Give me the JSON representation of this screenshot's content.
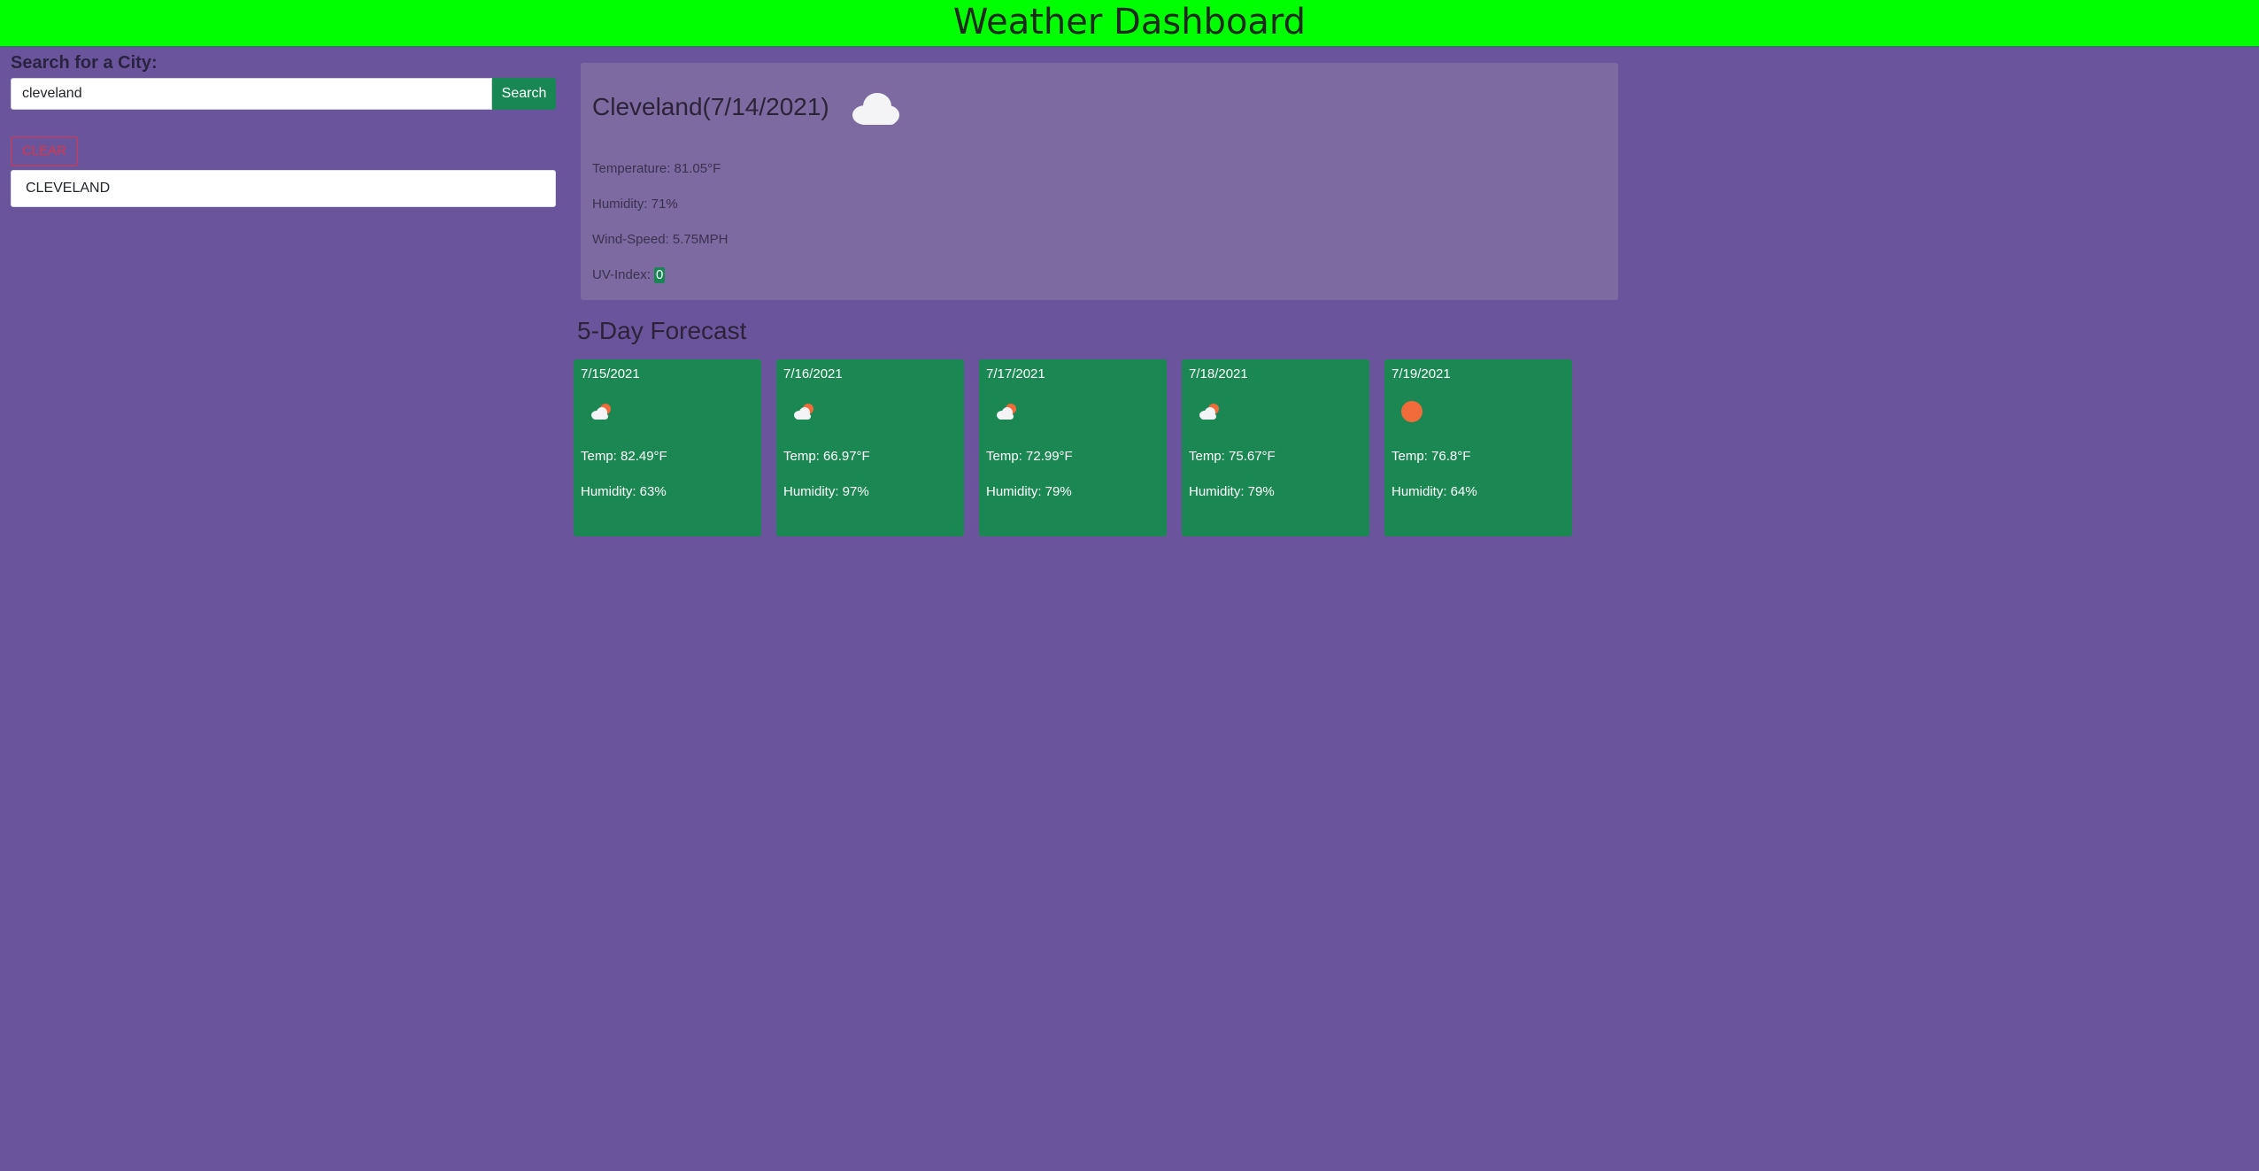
{
  "header": {
    "title": "Weather Dashboard"
  },
  "sidebar": {
    "search_label": "Search for a City:",
    "search_value": "cleveland",
    "search_button_label": "Search",
    "clear_button_label": "CLEAR",
    "history": [
      {
        "label": "CLEVELAND"
      }
    ]
  },
  "current": {
    "title": "Cleveland(7/14/2021)",
    "icon": "cloud-icon",
    "temperature_label": "Temperature: 81.05°F",
    "humidity_label": "Humidity: 71%",
    "wind_label": "Wind-Speed: 5.75MPH",
    "uv_label": "UV-Index: ",
    "uv_value": "0"
  },
  "forecast": {
    "heading": "5-Day Forecast",
    "days": [
      {
        "date": "7/15/2021",
        "icon": "partly-cloudy-icon",
        "temp": "Temp: 82.49°F",
        "humidity": "Humidity: 63%"
      },
      {
        "date": "7/16/2021",
        "icon": "partly-cloudy-icon",
        "temp": "Temp: 66.97°F",
        "humidity": "Humidity: 97%"
      },
      {
        "date": "7/17/2021",
        "icon": "partly-cloudy-icon",
        "temp": "Temp: 72.99°F",
        "humidity": "Humidity: 79%"
      },
      {
        "date": "7/18/2021",
        "icon": "partly-cloudy-icon",
        "temp": "Temp: 75.67°F",
        "humidity": "Humidity: 79%"
      },
      {
        "date": "7/19/2021",
        "icon": "sun-icon",
        "temp": "Temp: 76.8°F",
        "humidity": "Humidity: 64%"
      }
    ]
  },
  "colors": {
    "background": "#6a559c",
    "header": "#00ff00",
    "card": "#1b8752",
    "current_panel": "#7c6aa0",
    "clear": "#dc3545",
    "sun": "#f26b3a"
  }
}
